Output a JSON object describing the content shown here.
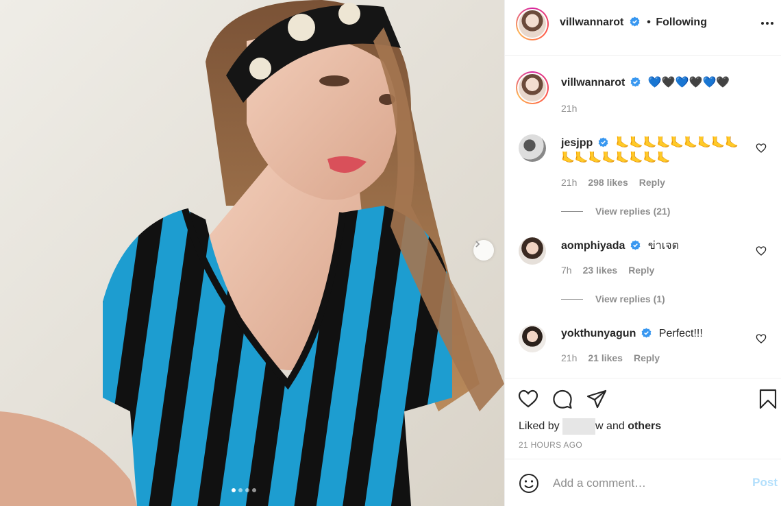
{
  "post": {
    "image_slides": 4,
    "active_slide": 1,
    "next_icon": "chevron-right-icon"
  },
  "header": {
    "username": "villwannarot",
    "separator": "•",
    "following_label": "Following",
    "more_icon": "more-horizontal-icon"
  },
  "caption": {
    "username": "villwannarot",
    "text": "💙🖤💙🖤💙🖤",
    "time": "21h"
  },
  "comments": [
    {
      "username": "jesjpp",
      "text": "🦶🦶🦶🦶🦶🦶🦶🦶🦶🦶🦶🦶🦶🦶🦶🦶🦶",
      "time": "21h",
      "likes": "298 likes",
      "reply_label": "Reply",
      "view_replies": "View replies (21)"
    },
    {
      "username": "aomphiyada",
      "text": "ข่าเจต",
      "time": "7h",
      "likes": "23 likes",
      "reply_label": "Reply",
      "view_replies": "View replies (1)"
    },
    {
      "username": "yokthunyagun",
      "text": "Perfect!!!",
      "time": "21h",
      "likes": "21 likes",
      "reply_label": "Reply"
    }
  ],
  "actions": {
    "like_icon": "heart-icon",
    "comment_icon": "comment-icon",
    "share_icon": "share-icon",
    "save_icon": "bookmark-icon",
    "liked_by_prefix": "Liked by",
    "liked_by_suffix": "w and",
    "liked_by_others": "others",
    "time_ago": "21 HOURS AGO"
  },
  "add_comment": {
    "emoji_icon": "smiley-icon",
    "placeholder": "Add a comment…",
    "post_label": "Post"
  },
  "colors": {
    "verified": "#3897f0",
    "post_disabled": "#b2dffc",
    "muted_text": "#8e8e8e",
    "border": "#efefef"
  }
}
